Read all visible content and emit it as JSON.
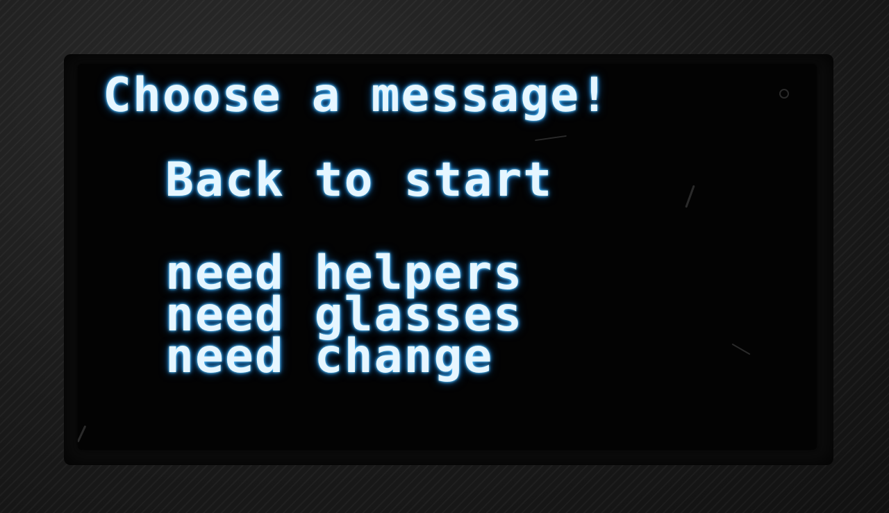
{
  "screen": {
    "title": "Choose a message!",
    "menu_items": [
      "Back to start",
      "need helpers",
      "need glasses",
      "need change"
    ]
  },
  "colors": {
    "text": "#e6f6ff",
    "glow": "#2aa7ff",
    "screen_bg": "#030303",
    "casing": "#1b1b1b"
  }
}
